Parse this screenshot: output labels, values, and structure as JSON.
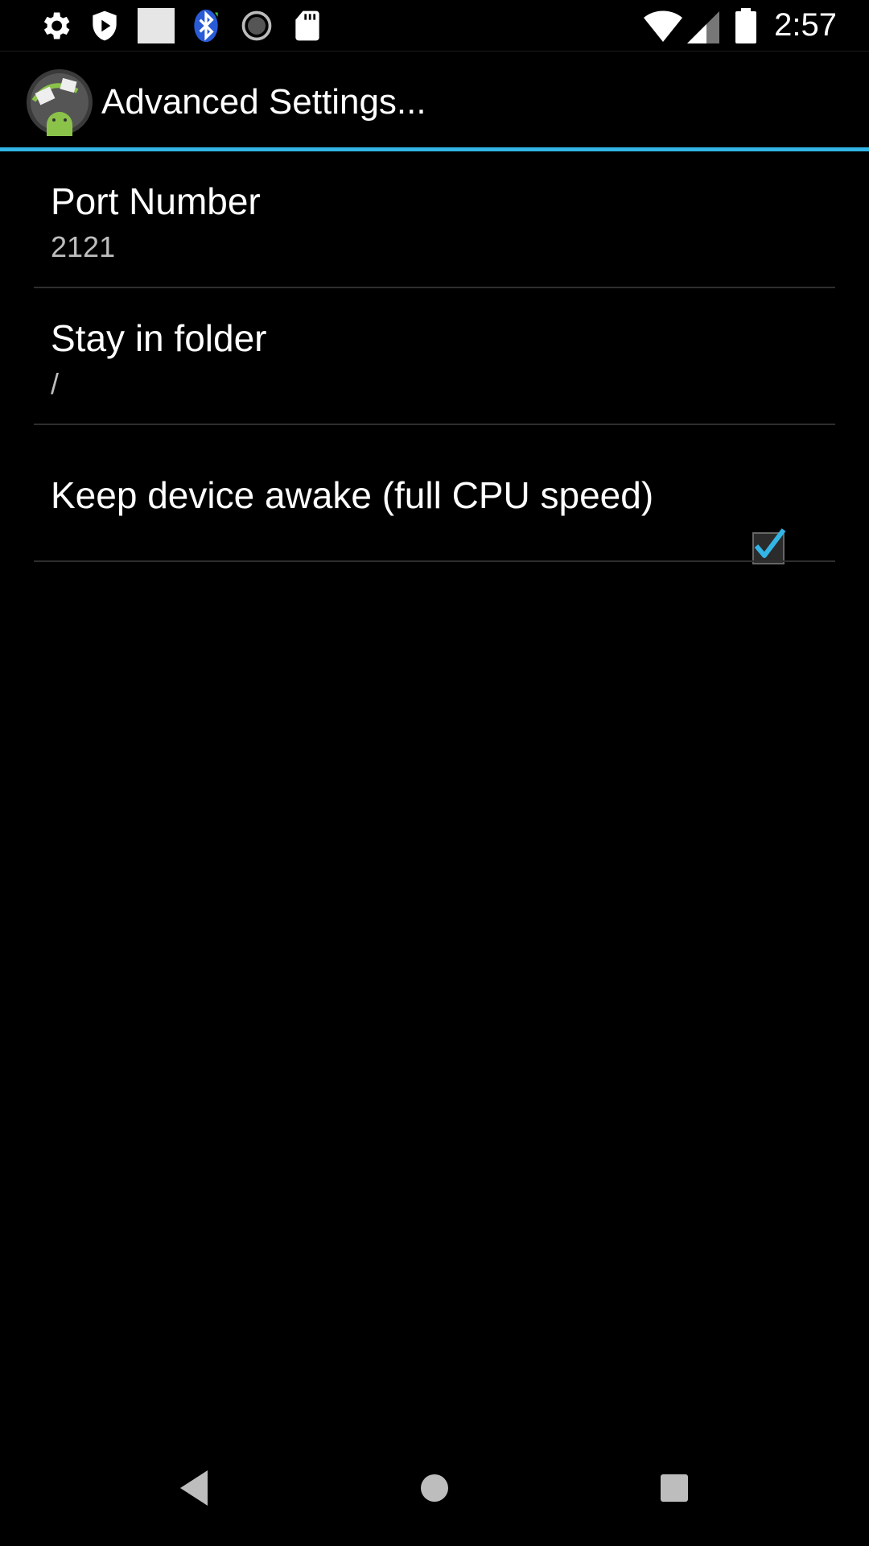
{
  "status_bar": {
    "time": "2:57",
    "left_icons": [
      "gear-icon",
      "shield-play-icon",
      "blank-square-icon",
      "bluetooth-icon",
      "sync-circle-icon",
      "sd-card-icon"
    ],
    "right_icons": [
      "wifi-icon",
      "cell-signal-icon",
      "battery-icon"
    ]
  },
  "action_bar": {
    "title": "Advanced Settings..."
  },
  "preferences": [
    {
      "title": "Port Number",
      "summary": "2121"
    },
    {
      "title": "Stay in folder",
      "summary": "/"
    },
    {
      "title": "Keep device awake (full CPU speed)",
      "checked": true
    }
  ],
  "colors": {
    "accent": "#33b5e5",
    "background": "#000000",
    "summary_text": "#bdbdbd"
  },
  "nav_bar": [
    "back-icon",
    "home-icon",
    "recents-icon"
  ]
}
